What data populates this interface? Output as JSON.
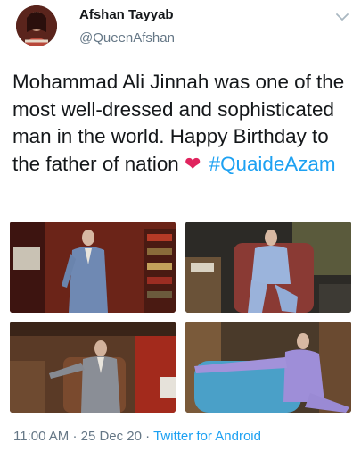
{
  "author": {
    "name": "Afshan Tayyab",
    "handle": "@QueenAfshan",
    "avatar_icon": "profile-avatar"
  },
  "tweet": {
    "text_main": "Mohammad Ali Jinnah was one of the most well-dressed and sophisticated man in the world. Happy Birthday to the father of nation",
    "heart_emoji": "❤",
    "hashtag": "#QuaideAzam"
  },
  "media": {
    "photos": [
      "photo-standing-suit",
      "photo-seated-blue-chair",
      "photo-seated-study",
      "photo-reclining-armchair"
    ]
  },
  "meta": {
    "time": "11:00 AM",
    "separator": "·",
    "date": "25 Dec 20",
    "source": "Twitter for Android"
  },
  "colors": {
    "link": "#1da1f2",
    "secondary_text": "#657786",
    "heart": "#e0245e"
  }
}
